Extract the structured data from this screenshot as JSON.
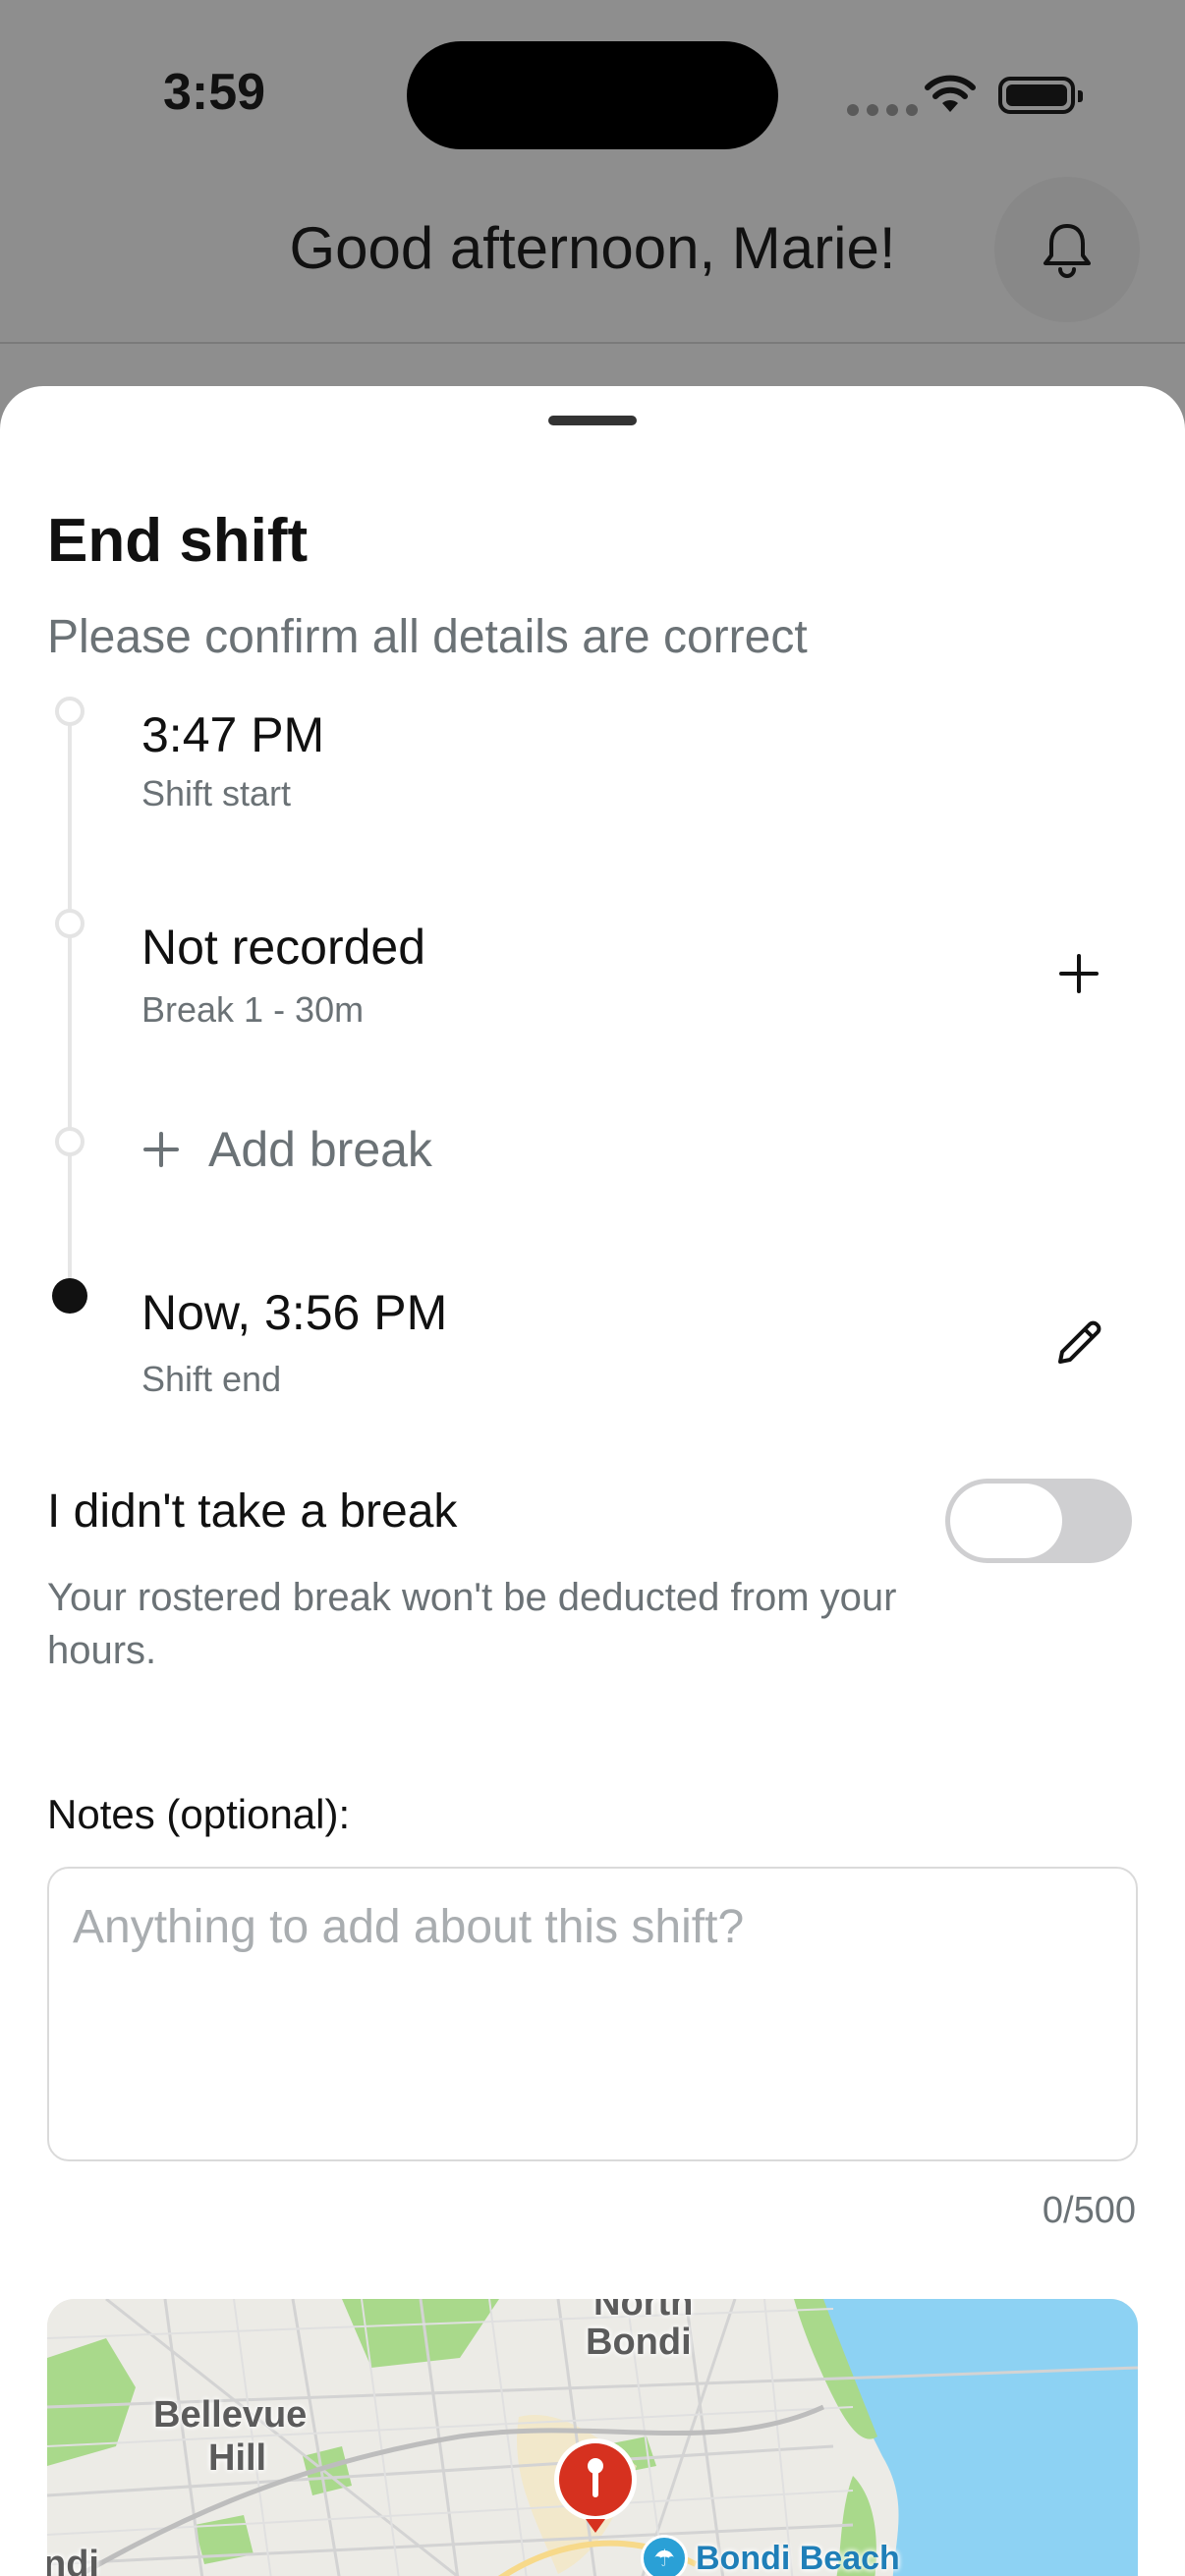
{
  "status_bar": {
    "time": "3:59"
  },
  "header": {
    "greeting": "Good afternoon, Marie!",
    "notification_icon": "bell-icon"
  },
  "sheet": {
    "title": "End shift",
    "subtitle": "Please confirm all details are correct",
    "timeline": {
      "shift_start": {
        "time": "3:47 PM",
        "label": "Shift start"
      },
      "break_1": {
        "status": "Not recorded",
        "label": "Break 1 - 30m",
        "action_icon": "plus-icon"
      },
      "add_break": {
        "label": "Add break",
        "icon": "plus-icon"
      },
      "shift_end": {
        "time": "Now, 3:56 PM",
        "label": "Shift end",
        "action_icon": "pencil-icon"
      }
    },
    "no_break": {
      "label": "I didn't take a break",
      "description": "Your rostered break won't be deducted from your hours.",
      "enabled": false
    },
    "notes": {
      "label": "Notes (optional):",
      "placeholder": "Anything to add about this shift?",
      "value": "",
      "counter": "0/500"
    },
    "map": {
      "labels": {
        "north": "North",
        "bondi": "Bondi",
        "bellevue": "Bellevue",
        "hill": "Hill",
        "left_edge": "ndi",
        "beach": "Bondi Beach"
      },
      "colors": {
        "water": "#8dd2f3",
        "park": "#a9d98b",
        "land": "#ecebe6",
        "pin": "#d6311f"
      }
    }
  }
}
